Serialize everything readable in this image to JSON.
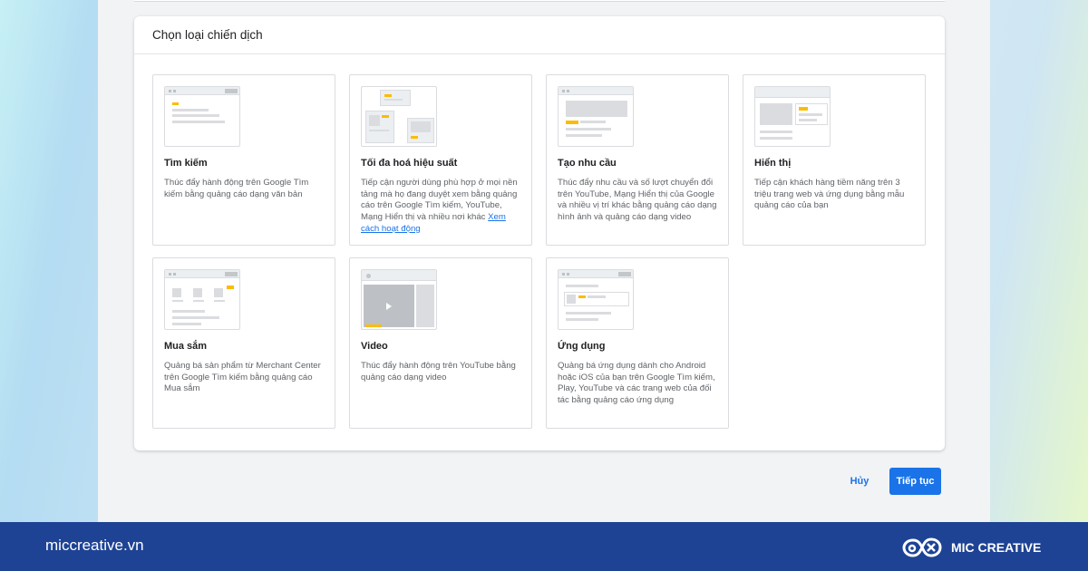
{
  "panel": {
    "title": "Chọn loại chiến dịch"
  },
  "campaigns": [
    {
      "title": "Tìm kiếm",
      "description": "Thúc đẩy hành động trên Google Tìm kiếm bằng quảng cáo dạng văn bản"
    },
    {
      "title": "Tối đa hoá hiệu suất",
      "description": "Tiếp cận người dùng phù hợp ở mọi nền tảng mà họ đang duyệt xem bằng quảng cáo trên Google Tìm kiếm, YouTube, Mạng Hiển thị và nhiều nơi khác",
      "link": "Xem cách hoạt động"
    },
    {
      "title": "Tạo nhu cầu",
      "description": "Thúc đẩy nhu cầu và số lượt chuyển đổi trên YouTube, Mạng Hiển thị của Google và nhiều vị trí khác bằng quảng cáo dạng hình ảnh và quảng cáo dạng video"
    },
    {
      "title": "Hiển thị",
      "description": "Tiếp cận khách hàng tiềm năng trên 3 triệu trang web và ứng dụng bằng mẫu quảng cáo của bạn"
    },
    {
      "title": "Mua sắm",
      "description": "Quảng bá sản phẩm từ Merchant Center trên Google Tìm kiếm bằng quảng cáo Mua sắm"
    },
    {
      "title": "Video",
      "description": "Thúc đẩy hành động trên YouTube bằng quảng cáo dạng video"
    },
    {
      "title": "Ứng dụng",
      "description": "Quảng bá ứng dụng dành cho Android hoặc iOS của bạn trên Google Tìm kiếm, Play, YouTube và các trang web của đối tác bằng quảng cáo ứng dụng"
    }
  ],
  "actions": {
    "cancel_label": "Hủy",
    "next_label": "Tiếp tục"
  },
  "footer": {
    "site_url": "miccreative.vn",
    "brand_name": "MIC CREATIVE"
  },
  "colors": {
    "accent": "#1a73e8",
    "footer_bg": "#1e4395",
    "highlight": "#fbbc04"
  }
}
